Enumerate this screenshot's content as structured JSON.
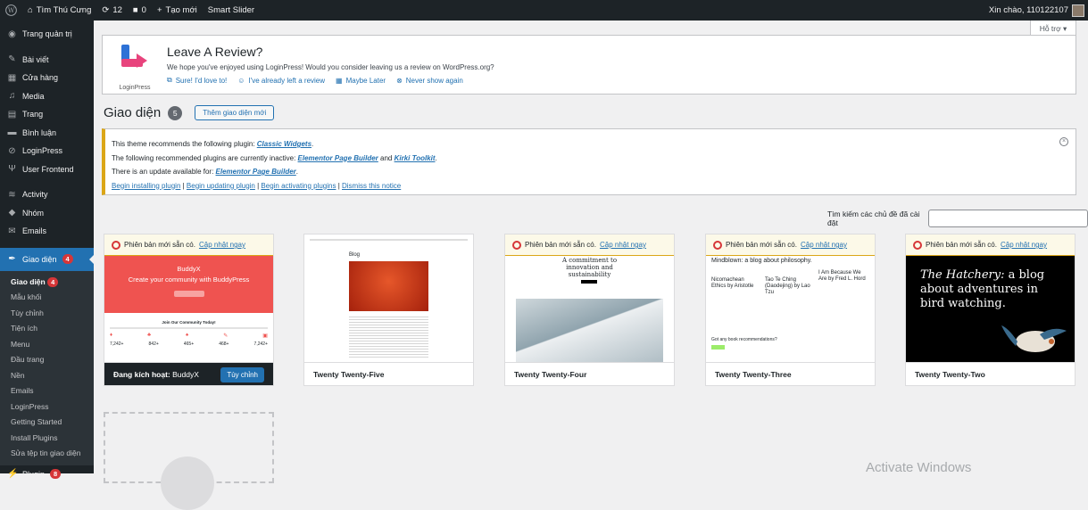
{
  "admin_bar": {
    "site_name": "Tìm Thú Cưng",
    "updates_count": "12",
    "comments_count": "0",
    "new_label": "Tạo mới",
    "smart_slider": "Smart Slider",
    "greeting": "Xin chào, 110122107"
  },
  "sidebar": {
    "items": [
      {
        "label": "Trang quản trị",
        "icon": "dashboard-icon"
      },
      {
        "label": "Bài viết",
        "icon": "pin-icon"
      },
      {
        "label": "Cửa hàng",
        "icon": "store-icon"
      },
      {
        "label": "Media",
        "icon": "media-icon"
      },
      {
        "label": "Trang",
        "icon": "page-icon"
      },
      {
        "label": "Bình luận",
        "icon": "comment-icon"
      },
      {
        "label": "LoginPress",
        "icon": "loginpress-icon"
      },
      {
        "label": "User Frontend",
        "icon": "user-frontend-icon"
      },
      {
        "label": "Activity",
        "icon": "activity-icon"
      },
      {
        "label": "Nhóm",
        "icon": "groups-icon"
      },
      {
        "label": "Emails",
        "icon": "email-icon"
      }
    ],
    "current": {
      "label": "Giao diện",
      "badge": "4"
    },
    "submenu": [
      "Giao diện",
      "Mẫu khối",
      "Tùy chỉnh",
      "Tiện ích",
      "Menu",
      "Đầu trang",
      "Nền",
      "Emails",
      "LoginPress",
      "Getting Started",
      "Install Plugins",
      "Sửa tệp tin giao diện"
    ],
    "submenu_badge": "4",
    "plugin": {
      "label": "Plugin",
      "badge": "8"
    }
  },
  "help_tab": "Hỗ trợ ▾",
  "review": {
    "title": "Leave A Review?",
    "text": "We hope you've enjoyed using LoginPress! Would you consider leaving us a review on WordPress.org?",
    "logo_text": "LoginPress",
    "links": [
      "Sure! I'd love to!",
      "I've already left a review",
      "Maybe Later",
      "Never show again"
    ]
  },
  "page": {
    "title": "Giao diện",
    "count": "5",
    "add_new": "Thêm giao diện mới"
  },
  "notice": {
    "line1_prefix": "This theme recommends the following plugin: ",
    "line1_link": "Classic Widgets",
    "line2_prefix": "The following recommended plugins are currently inactive: ",
    "line2_link1": "Elementor Page Builder",
    "line2_and": " and ",
    "line2_link2": "Kirki Toolkit",
    "line3_prefix": "There is an update available for: ",
    "line3_link": "Elementor Page Builder",
    "actions": [
      "Begin installing plugin",
      "Begin updating plugin",
      "Begin activating plugins",
      "Dismiss this notice"
    ]
  },
  "search": {
    "label": "Tìm kiếm các chủ đề đã cài đặt",
    "value": ""
  },
  "themes": [
    {
      "name": "BuddyX",
      "active_label": "Đang kích hoạt:",
      "customize": "Tùy chỉnh",
      "update_text": "Phiên bản mới sẵn có.",
      "update_link": "Cập nhật ngay",
      "shot": {
        "hero_title": "BuddyX",
        "hero_sub": "Create your community with BuddyPress",
        "join": "Join Our Community Today!",
        "stats": [
          "7,242+",
          "842+",
          "465+",
          "468+",
          "7,242+"
        ]
      }
    },
    {
      "name": "Twenty Twenty-Five",
      "shot": {
        "heading": "Blog"
      }
    },
    {
      "name": "Twenty Twenty-Four",
      "update_text": "Phiên bản mới sẵn có.",
      "update_link": "Cập nhật ngay",
      "shot": {
        "heading": "A commitment to innovation and sustainability"
      }
    },
    {
      "name": "Twenty Twenty-Three",
      "update_text": "Phiên bản mới sẵn có.",
      "update_link": "Cập nhật ngay",
      "shot": {
        "heading": "Mindblown: a blog about philosophy.",
        "col1": "Nicomachean Ethics by Aristotle",
        "col2": "Tao Te Ching (Daodejing) by Lao Tzu",
        "col3": "I Am Because We Are by Fred L. Hord",
        "footer": "Got any book recommendations?"
      }
    },
    {
      "name": "Twenty Twenty-Two",
      "update_text": "Phiên bản mới sẵn có.",
      "update_link": "Cập nhật ngay",
      "shot": {
        "heading_em": "The Hatchery:",
        "heading_rest": " a blog about adventures in bird watching."
      }
    }
  ],
  "watermark": "Activate Windows",
  "colors": {
    "admin_dark": "#1d2327",
    "accent": "#2271b1",
    "warning": "#dba617",
    "badge": "#d63638",
    "buddyx_red": "#ef5350"
  }
}
